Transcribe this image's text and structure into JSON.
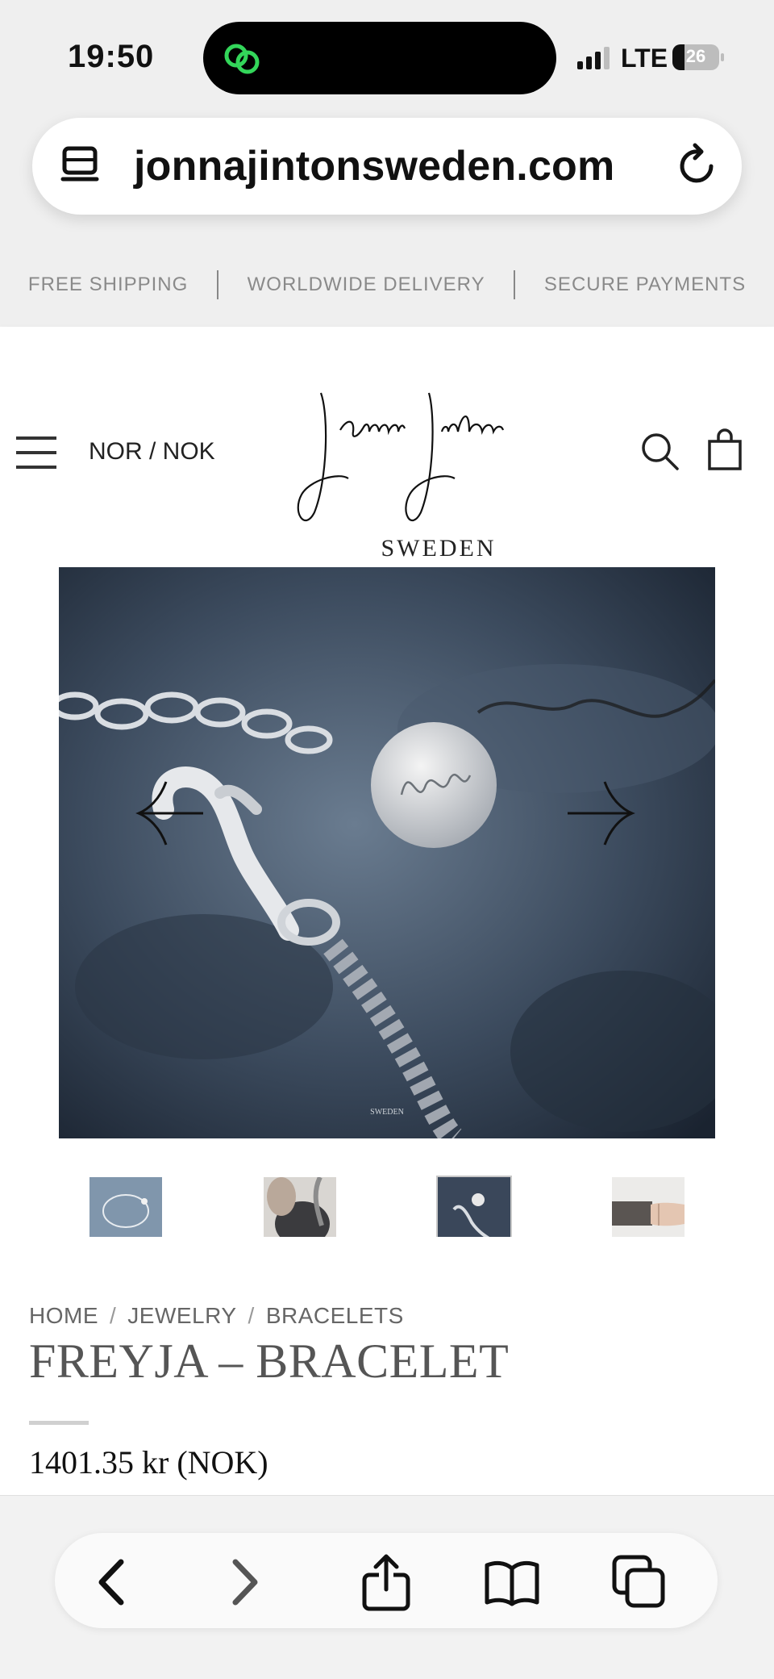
{
  "status_bar": {
    "time": "19:50",
    "network": "LTE",
    "battery_percent": "26",
    "battery_level": 0.26
  },
  "browser": {
    "url": "jonnajintonsweden.com"
  },
  "promo": {
    "items": [
      "FREE SHIPPING",
      "WORLDWIDE DELIVERY",
      "SECURE PAYMENTS"
    ]
  },
  "header": {
    "locale": "NOR / NOK",
    "logo_subtitle": "SWEDEN",
    "logo_script": "Jonna Jinton"
  },
  "gallery": {
    "active_index": 2,
    "thumbnail_count": 4
  },
  "product": {
    "breadcrumb": [
      "HOME",
      "JEWELRY",
      "BRACELETS"
    ],
    "breadcrumb_sep": "/",
    "title": "FREYJA – BRACELET",
    "price": "1401.35 kr (NOK)"
  },
  "icons": {
    "status": [
      "dynamic-island-link-icon",
      "signal-icon",
      "battery-icon"
    ],
    "urlbar": [
      "reader-mode-icon",
      "reload-icon"
    ],
    "header": [
      "hamburger-menu-icon",
      "search-icon",
      "shopping-bag-icon"
    ],
    "gallery": [
      "arrow-left-icon",
      "arrow-right-icon"
    ],
    "toolbar": [
      "back-icon",
      "forward-icon",
      "share-icon",
      "bookmarks-icon",
      "tabs-icon"
    ]
  },
  "colors": {
    "island_icon": "#33d65a",
    "promo_text": "#8a8a8a",
    "title_text": "#555555"
  }
}
